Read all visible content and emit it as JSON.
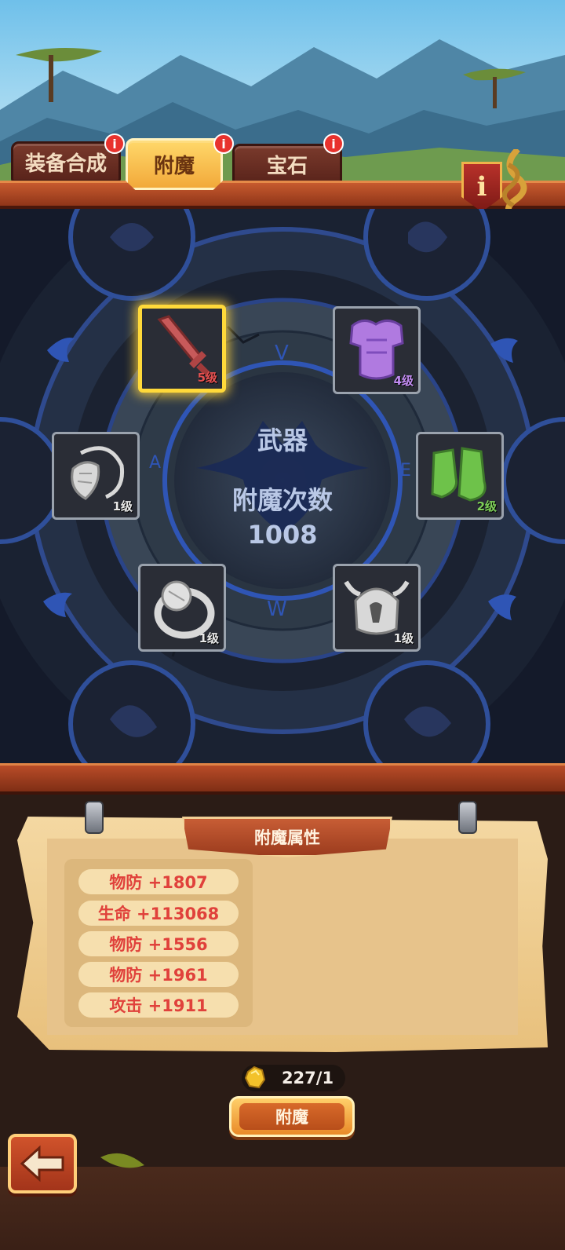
{
  "tabs": [
    {
      "label": "装备合成",
      "badge": "i",
      "active": false
    },
    {
      "label": "附魔",
      "badge": "i",
      "active": true
    },
    {
      "label": "宝石",
      "badge": "i",
      "active": false
    }
  ],
  "info_button": {
    "glyph": "i",
    "icon": "info-shield-icon"
  },
  "center": {
    "category": "武器",
    "count_label": "附魔次数",
    "count_value": "1008"
  },
  "slots": [
    {
      "name": "weapon",
      "icon": "sword-icon",
      "level": "5级",
      "selected": true,
      "color": "#c85a5a"
    },
    {
      "name": "armor",
      "icon": "chest-armor-icon",
      "level": "4级",
      "selected": false,
      "color": "#b07ae0"
    },
    {
      "name": "necklace",
      "icon": "necklace-icon",
      "level": "1级",
      "selected": false,
      "color": "#d8d8d8"
    },
    {
      "name": "boots",
      "icon": "boots-icon",
      "level": "2级",
      "selected": false,
      "color": "#6ec24a"
    },
    {
      "name": "ring",
      "icon": "ring-icon",
      "level": "1级",
      "selected": false,
      "color": "#d8d8d8"
    },
    {
      "name": "helmet",
      "icon": "helmet-icon",
      "level": "1级",
      "selected": false,
      "color": "#d8d8d8"
    }
  ],
  "attributes_panel": {
    "title": "附魔属性",
    "rows": [
      "物防 +1807",
      "生命 +113068",
      "物防 +1556",
      "物防 +1961",
      "攻击 +1911"
    ]
  },
  "cost": {
    "icon": "gold-ore-icon",
    "text": "227/1"
  },
  "enchant_button": {
    "label": "附魔"
  },
  "back_button": {
    "icon": "back-arrow-icon"
  },
  "colors": {
    "accent_gold": "#ffd93a",
    "attr_text": "#e0413b",
    "tab_active": "#f2a93a",
    "tab_inactive": "#6a2e22"
  }
}
